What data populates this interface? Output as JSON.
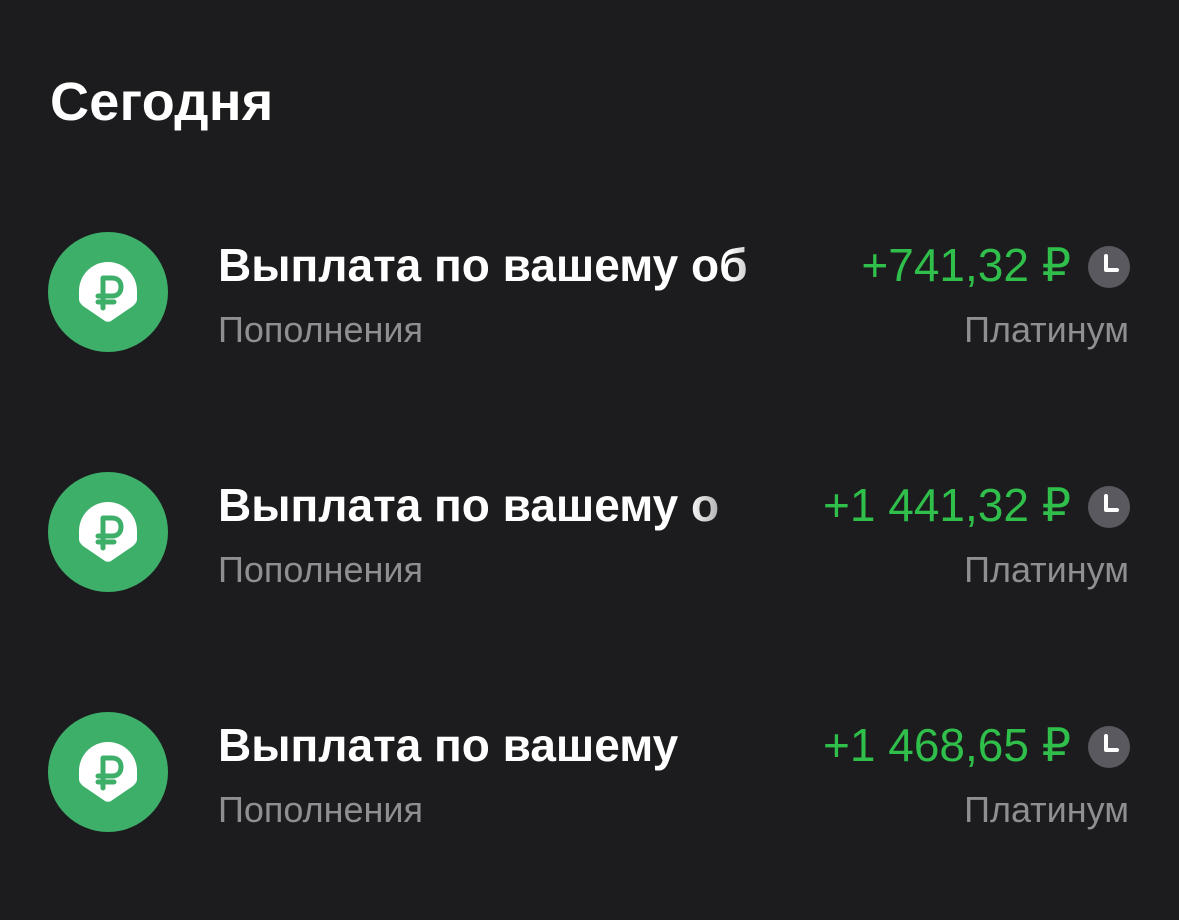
{
  "section": {
    "title": "Сегодня"
  },
  "colors": {
    "background": "#1c1c1e",
    "icon_green": "#3daf68",
    "amount_green": "#2fbf4a",
    "secondary_text": "#8e8e93",
    "status_icon": "#59595f"
  },
  "operations": [
    {
      "title": "Выплата по вашему об",
      "category": "Пополнения",
      "amount": "+741,32 ₽",
      "account": "Платинум",
      "icon": "ruble-badge-icon",
      "status_icon": "clock-icon"
    },
    {
      "title": "Выплата по вашему о",
      "category": "Пополнения",
      "amount": "+1 441,32 ₽",
      "account": "Платинум",
      "icon": "ruble-badge-icon",
      "status_icon": "clock-icon"
    },
    {
      "title": "Выплата по вашему",
      "category": "Пополнения",
      "amount": "+1 468,65 ₽",
      "account": "Платинум",
      "icon": "ruble-badge-icon",
      "status_icon": "clock-icon"
    }
  ]
}
